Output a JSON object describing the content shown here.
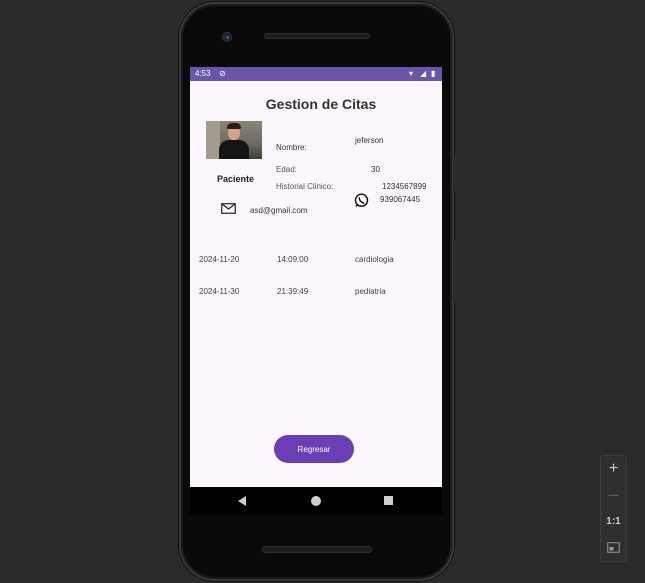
{
  "statusbar": {
    "time": "4:53",
    "icons": [
      "sync-icon",
      "wifi-icon",
      "signal-icon",
      "battery-icon"
    ]
  },
  "screen": {
    "title": "Gestion de Citas",
    "patient": {
      "role_label": "Paciente",
      "name_label": "Nombre:",
      "name_value": "jeferson",
      "age_label": "Edad:",
      "age_value": "30",
      "history_label": "Historial Clinico:",
      "history_value": "1234567899",
      "email": "asd@gmail.com",
      "phone": "939067445"
    },
    "appointments": [
      {
        "date": "2024-11-20",
        "time": "14:09:00",
        "specialty": "cardiologia"
      },
      {
        "date": "2024-11-30",
        "time": "21:39:49",
        "specialty": "pediatria"
      }
    ],
    "back_button": "Regresar"
  },
  "emulator_controls": {
    "zoom_in": "+",
    "zoom_out": "—",
    "reset": "1:1"
  },
  "colors": {
    "accent": "#6a3fb5",
    "statusbar": "#6b55a8",
    "background": "#fdf6fd"
  }
}
